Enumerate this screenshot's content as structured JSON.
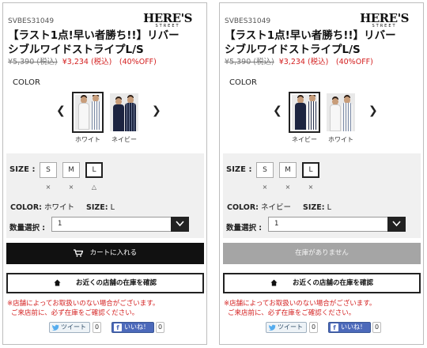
{
  "brand": {
    "logo_main": "HERE'S",
    "logo_sub": "STREET"
  },
  "colors": {
    "accent_red": "#d42020",
    "button_dark": "#111111",
    "button_disabled": "#a5a5a5"
  },
  "panels": [
    {
      "sku": "SVBES31049",
      "title_line1": "【ラスト1点!早い者勝ち!!】リバー",
      "title_line2": "シブルワイドストライプL/S",
      "price_old": "¥5,390 (税込)",
      "price_new": "¥3,234 (税込)　(40%OFF)",
      "color_label": "COLOR",
      "swatches": [
        {
          "name": "ホワイト",
          "selected": true
        },
        {
          "name": "ネイビー",
          "selected": false
        }
      ],
      "size_label": "SIZE :",
      "sizes": [
        {
          "label": "S",
          "stock": "×"
        },
        {
          "label": "M",
          "stock": "×"
        },
        {
          "label": "L",
          "stock": "△"
        }
      ],
      "selected_color_label": "COLOR:",
      "selected_color": "ホワイト",
      "selected_size_label": "SIZE:",
      "selected_size": "L",
      "qty_label": "数量選択 :",
      "qty_value": "1",
      "cart_button": "カートに入れる",
      "store_button": "お近くの店舗の在庫を確認",
      "note_line1": "※店舗によってお取扱いのない場合がございます。",
      "note_line2": "ご来店前に、必ず在庫をご確認ください。",
      "tweet_label": "ツイート",
      "tweet_count": "0",
      "like_label": "いいね！",
      "like_count": "0"
    },
    {
      "sku": "SVBES31049",
      "title_line1": "【ラスト1点!早い者勝ち!!】リバー",
      "title_line2": "シブルワイドストライプL/S",
      "price_old": "¥5,390 (税込)",
      "price_new": "¥3,234 (税込)　(40%OFF)",
      "color_label": "COLOR",
      "swatches": [
        {
          "name": "ネイビー",
          "selected": true
        },
        {
          "name": "ホワイト",
          "selected": false
        }
      ],
      "size_label": "SIZE :",
      "sizes": [
        {
          "label": "S",
          "stock": "×"
        },
        {
          "label": "M",
          "stock": "×"
        },
        {
          "label": "L",
          "stock": "×"
        }
      ],
      "selected_color_label": "COLOR:",
      "selected_color": "ネイビー",
      "selected_size_label": "SIZE:",
      "selected_size": "L",
      "qty_label": "数量選択 :",
      "qty_value": "1",
      "cart_button": "在庫がありません",
      "store_button": "お近くの店舗の在庫を確認",
      "note_line1": "※店舗によってお取扱いのない場合がございます。",
      "note_line2": "ご来店前に、必ず在庫をご確認ください。",
      "tweet_label": "ツイート",
      "tweet_count": "0",
      "like_label": "いいね！",
      "like_count": "0"
    }
  ]
}
